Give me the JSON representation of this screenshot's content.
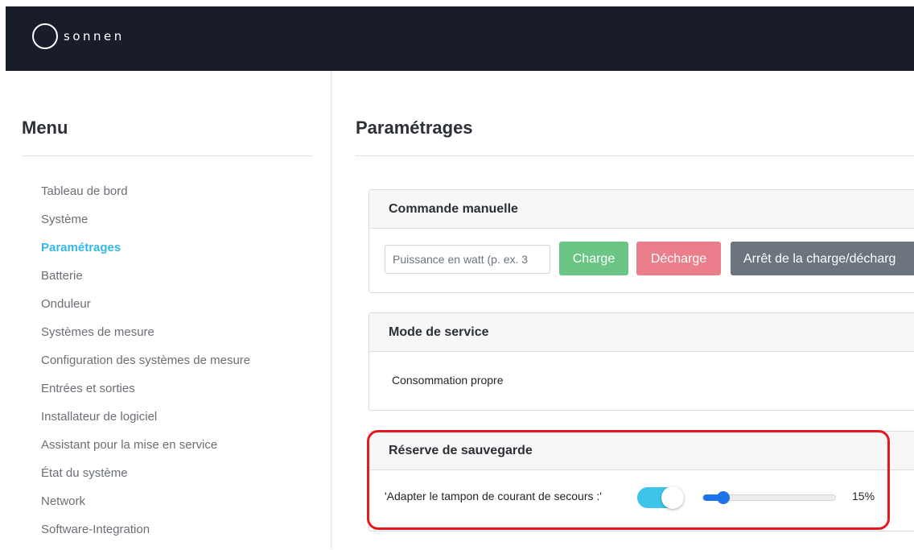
{
  "brand": {
    "name": "sonnen"
  },
  "sidebar": {
    "title": "Menu",
    "items": [
      {
        "label": "Tableau de bord",
        "active": false
      },
      {
        "label": "Système",
        "active": false
      },
      {
        "label": "Paramétrages",
        "active": true
      },
      {
        "label": "Batterie",
        "active": false
      },
      {
        "label": "Onduleur",
        "active": false
      },
      {
        "label": "Systèmes de mesure",
        "active": false
      },
      {
        "label": "Configuration des systèmes de mesure",
        "active": false
      },
      {
        "label": "Entrées et sorties",
        "active": false
      },
      {
        "label": "Installateur de logiciel",
        "active": false
      },
      {
        "label": "Assistant pour la mise en service",
        "active": false
      },
      {
        "label": "État du système",
        "active": false
      },
      {
        "label": "Network",
        "active": false
      },
      {
        "label": "Software-Integration",
        "active": false
      }
    ]
  },
  "main": {
    "title": "Paramétrages",
    "manual_control": {
      "title": "Commande manuelle",
      "power_placeholder": "Puissance en watt (p. ex. 3",
      "power_value": "",
      "charge_label": "Charge",
      "discharge_label": "Décharge",
      "stop_label": "Arrêt de la charge/décharg"
    },
    "service_mode": {
      "title": "Mode de service",
      "value": "Consommation propre"
    },
    "backup_reserve": {
      "title": "Réserve de sauvegarde",
      "label": "'Adapter le tampon de courant de secours :'",
      "toggle_on": true,
      "slider_value": 15,
      "slider_min": 0,
      "slider_max": 100,
      "slider_display": "15%"
    }
  },
  "colors": {
    "header_bg": "#191d2a",
    "accent": "#36b8e6",
    "charge": "#6bc585",
    "discharge": "#ea7e8b",
    "stop": "#6c757d",
    "toggle": "#3fc4e9",
    "slider": "#1e73e8",
    "highlight": "#e3191f"
  }
}
